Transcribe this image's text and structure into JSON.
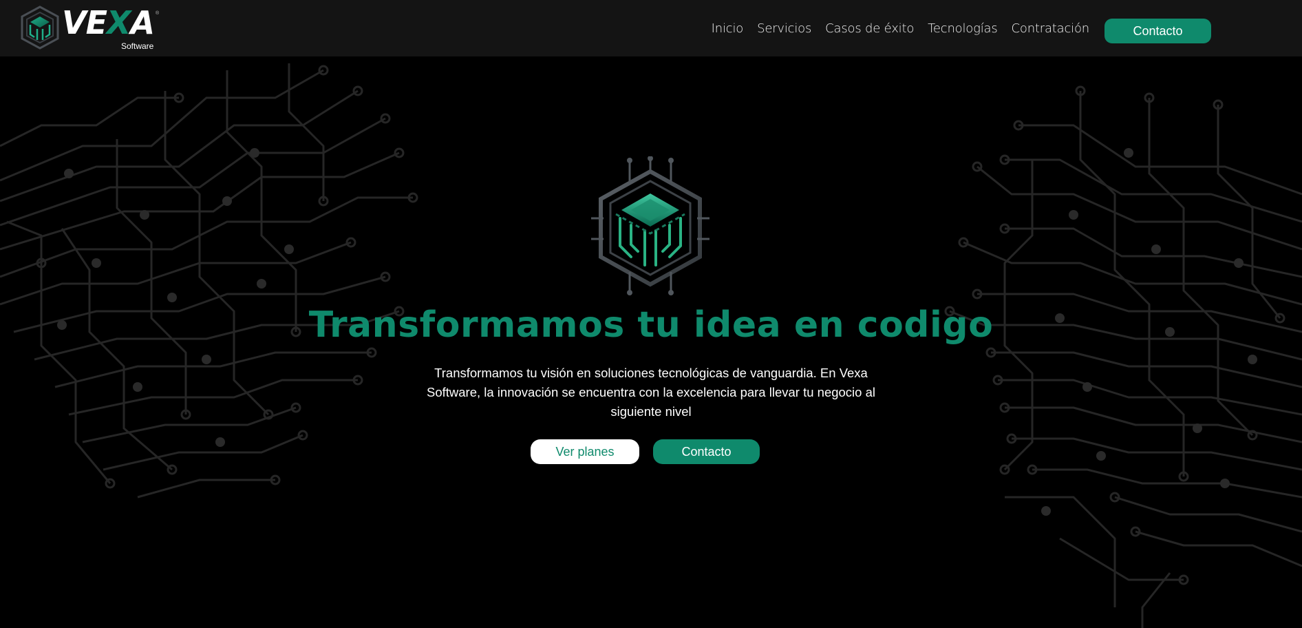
{
  "brand": {
    "wordmark_part1": "VE",
    "wordmark_x": "X",
    "wordmark_part2": "A",
    "subtitle": "Software",
    "registered": "®",
    "accent_color": "#0f8a6c"
  },
  "nav": {
    "items": [
      {
        "label": "Inicio"
      },
      {
        "label": "Servicios"
      },
      {
        "label": "Casos de éxito"
      },
      {
        "label": "Tecnologías"
      },
      {
        "label": "Contratación"
      }
    ],
    "cta_label": "Contacto"
  },
  "hero": {
    "icon": "vexa-cube-circuit-icon",
    "title": "Transformamos tu idea en codigo",
    "description": "Transformamos tu visión en soluciones tecnológicas de vanguardia. En Vexa Software, la innovación se encuentra con la excelencia para llevar tu negocio al siguiente nivel",
    "primary_button": "Ver planes",
    "secondary_button": "Contacto"
  },
  "background": {
    "pattern": "circuit-board-lines",
    "line_color": "#2a2a2a"
  }
}
